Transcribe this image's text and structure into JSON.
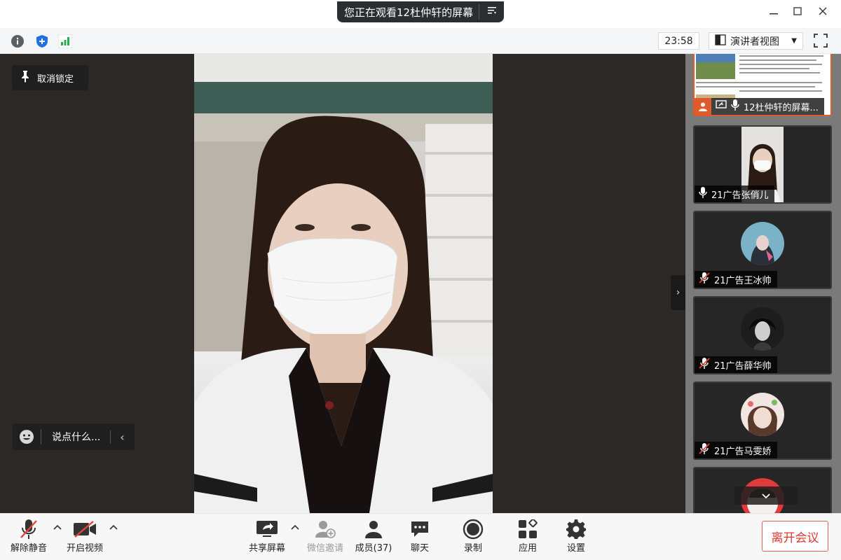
{
  "share_banner": {
    "text": "您正在观看12杜仲轩的屏幕"
  },
  "toolbar": {
    "time": "23:58",
    "view_label": "演讲者视图"
  },
  "stage": {
    "unlock_label": "取消锁定",
    "chat_placeholder": "说点什么..."
  },
  "participants": [
    {
      "name": "12杜仲轩的屏幕..."
    },
    {
      "name": "21广告张俏儿"
    },
    {
      "name": "21广告王冰帅"
    },
    {
      "name": "21广告薛华帅"
    },
    {
      "name": "21广告马雯娇"
    }
  ],
  "bottom": {
    "unmute": "解除静音",
    "start_video": "开启视频",
    "share_screen": "共享屏幕",
    "wechat_invite": "微信邀请",
    "members": "成员(37)",
    "chat": "聊天",
    "record": "录制",
    "apps": "应用",
    "settings": "设置",
    "leave": "离开会议"
  },
  "colors": {
    "leave_red": "#e1372f",
    "signal_green": "#22b14c",
    "shield_blue": "#1f6fe5"
  }
}
